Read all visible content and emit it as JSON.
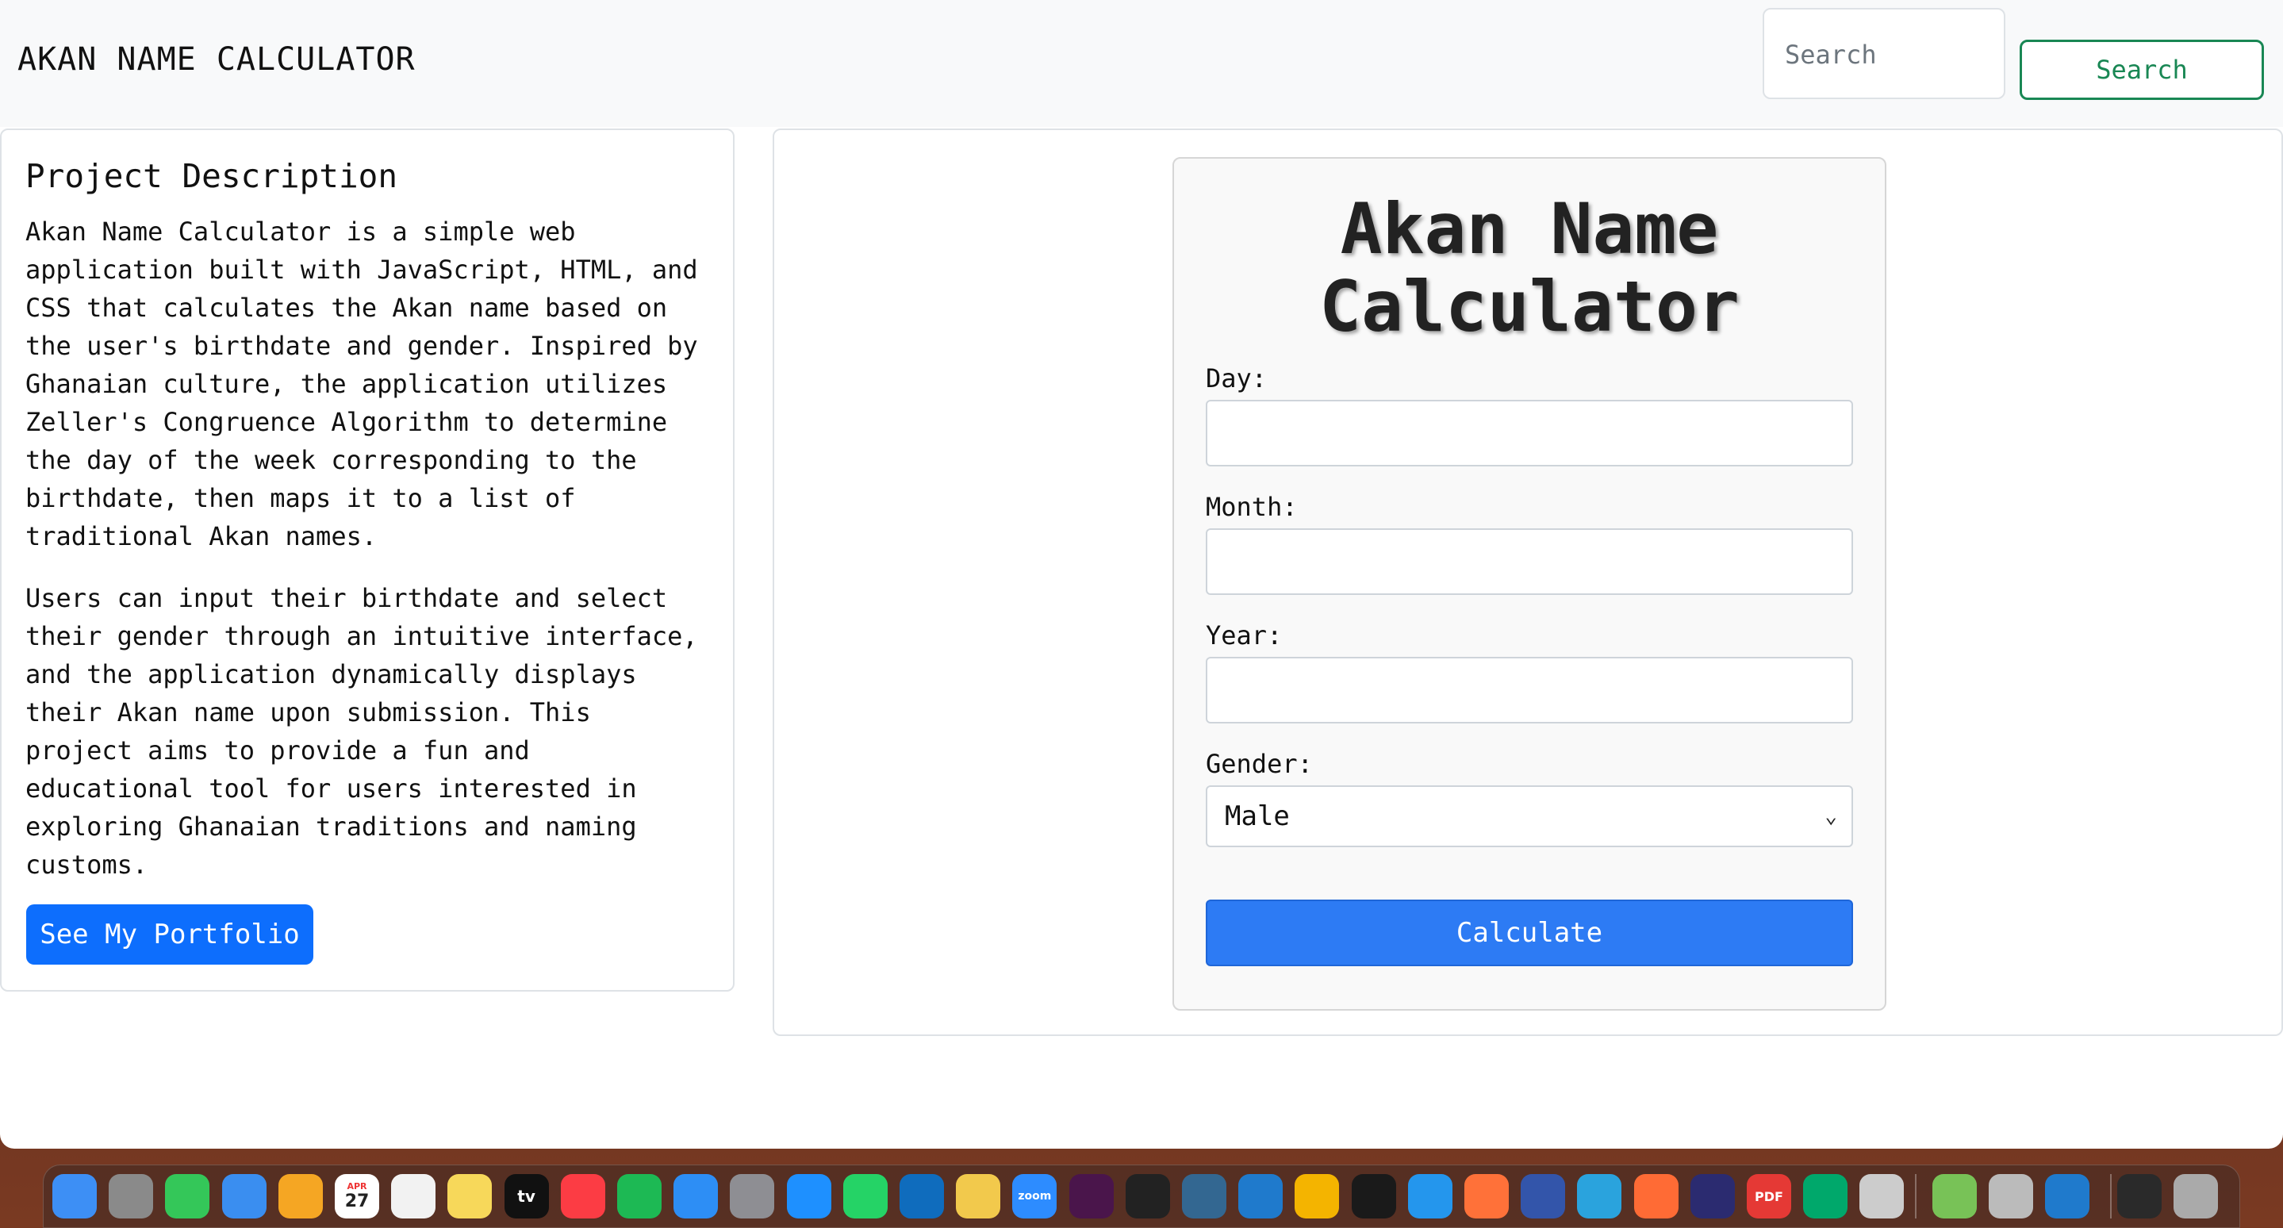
{
  "navbar": {
    "brand": "AKAN NAME CALCULATOR",
    "search_placeholder": "Search",
    "search_button": "Search"
  },
  "description": {
    "title": "Project Description",
    "paragraph_1": "Akan Name Calculator is a simple web application built with JavaScript, HTML, and CSS that calculates the Akan name based on the user's birthdate and gender. Inspired by Ghanaian culture, the application utilizes Zeller's Congruence Algorithm to determine the day of the week corresponding to the birthdate, then maps it to a list of traditional Akan names.",
    "paragraph_2": "Users can input their birthdate and select their gender through an intuitive interface, and the application dynamically displays their Akan name upon submission. This project aims to provide a fun and educational tool for users interested in exploring Ghanaian traditions and naming customs.",
    "portfolio_button": "See My Portfolio"
  },
  "form": {
    "title": "Akan Name Calculator",
    "day_label": "Day:",
    "day_value": "",
    "month_label": "Month:",
    "month_value": "",
    "year_label": "Year:",
    "year_value": "",
    "gender_label": "Gender:",
    "gender_selected": "Male",
    "calculate_button": "Calculate"
  },
  "dock": {
    "icons": [
      "finder-icon",
      "launchpad-icon",
      "messages-icon",
      "mail-icon",
      "photos-icon",
      "calendar-icon",
      "reminders-icon",
      "notes-icon",
      "appletv-icon",
      "music-icon",
      "spotify-icon",
      "appstore-icon",
      "settings-icon",
      "safari-icon",
      "whatsapp-icon",
      "outlook-icon",
      "bee-icon",
      "zoom-icon",
      "slack-icon",
      "terminal-icon",
      "postgres-icon",
      "vscode-icon",
      "chrome-icon",
      "intellij-icon",
      "docker-icon",
      "firefox-icon",
      "screen-icon",
      "telegram-icon",
      "editor-icon",
      "power-icon",
      "pdf-icon",
      "meet-icon",
      "roblox-icon",
      "utorrent-icon",
      "roblox-studio-icon",
      "vscode-insiders-icon",
      "keyboard-icon",
      "trash-icon"
    ],
    "calendar_month": "APR",
    "calendar_day": "27",
    "tv_label": "tv",
    "zoom_label": "zoom",
    "pdf_label": "PDF"
  },
  "colors": {
    "primary": "#0d6efd",
    "success": "#198754",
    "calculate": "#2d7bf4"
  }
}
